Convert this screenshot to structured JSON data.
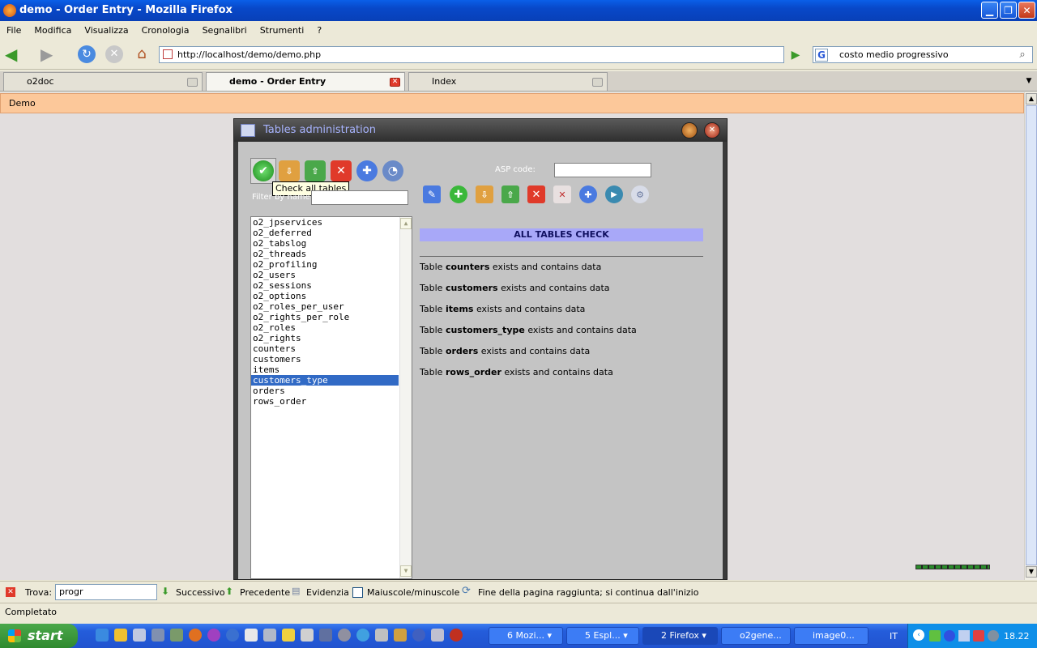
{
  "window": {
    "title": "demo - Order Entry - Mozilla Firefox"
  },
  "menu": [
    "File",
    "Modifica",
    "Visualizza",
    "Cronologia",
    "Segnalibri",
    "Strumenti",
    "?"
  ],
  "nav": {
    "url": "http://localhost/demo/demo.php",
    "search": "costo medio progressivo"
  },
  "tabs": [
    {
      "label": "o2doc"
    },
    {
      "label": "demo - Order Entry"
    },
    {
      "label": "Index"
    }
  ],
  "demobar": "Demo",
  "admin": {
    "title": "Tables administration",
    "tooltip": "Check all tables",
    "filter_label": "Filter by name:",
    "asp_label": "ASP code:",
    "header": "ALL TABLES CHECK",
    "tables": [
      "o2_jpservices",
      "o2_deferred",
      "o2_tabslog",
      "o2_threads",
      "o2_profiling",
      "o2_users",
      "o2_sessions",
      "o2_options",
      "o2_roles_per_user",
      "o2_rights_per_role",
      "o2_roles",
      "o2_rights",
      "counters",
      "customers",
      "items",
      "customers_type",
      "orders",
      "rows_order"
    ],
    "selected": "customers_type",
    "msg_prefix": "Table",
    "msg_suffix": "exists and contains data",
    "checked": [
      "counters",
      "customers",
      "items",
      "customers_type",
      "orders",
      "rows_order"
    ]
  },
  "findbar": {
    "label": "Trova:",
    "value": "progr",
    "next": "Successivo",
    "prev": "Precedente",
    "highlight": "Evidenzia",
    "matchcase": "Maiuscole/minuscole",
    "info": "Fine della pagina raggiunta; si continua dall'inizio"
  },
  "status": "Completato",
  "taskbar": {
    "start": "start",
    "items": [
      "6 Mozi...",
      "5 Espl...",
      "2 Firefox",
      "o2gene...",
      "image0..."
    ],
    "lang": "IT",
    "clock": "18.22"
  }
}
